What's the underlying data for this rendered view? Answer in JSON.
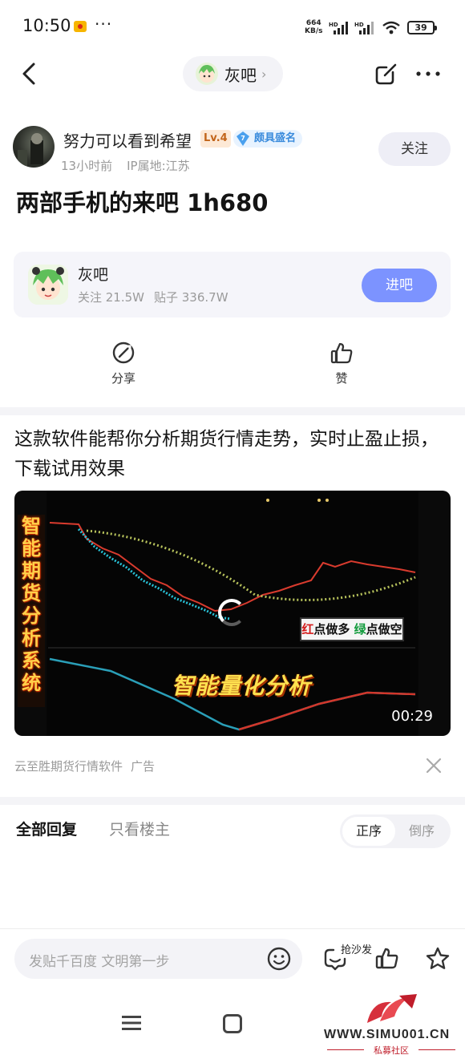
{
  "status_bar": {
    "time": "10:50",
    "dots": "···",
    "net_speed_value": "664",
    "net_speed_unit": "KB/s",
    "signal_tag_1": "HD",
    "signal_tag_2": "HD",
    "battery": "39"
  },
  "nav": {
    "forum_chip_label": "灰吧",
    "chip_arrow": "›"
  },
  "post": {
    "author": "努力可以看到希望",
    "level_badge": "Lv.4",
    "title_level": "7",
    "title_badge": "颇具盛名",
    "time_ago": "13小时前",
    "ip_location": "IP属地:江苏",
    "follow_label": "关注",
    "title": "两部手机的来吧 1h680"
  },
  "forum_card": {
    "name": "灰吧",
    "followers": "关注 21.5W",
    "posts": "贴子 336.7W",
    "enter_label": "进吧"
  },
  "actions": {
    "share_label": "分享",
    "like_label": "赞"
  },
  "ad": {
    "text": "这款软件能帮你分析期货行情走势，实时止盈止损，下载试用效果",
    "video_side_text": [
      "智",
      "能",
      "期",
      "货",
      "分",
      "析",
      "系",
      "统"
    ],
    "red_label": "红",
    "red_suffix": "点做多",
    "green_label": "绿",
    "green_suffix": "点做空",
    "banner_text": "智能量化分析",
    "duration": "00:29",
    "advertiser": "云至胜期货行情软件",
    "ad_tag": "广告"
  },
  "replies": {
    "tab_all": "全部回复",
    "tab_op_only": "只看楼主",
    "sort_asc": "正序",
    "sort_desc": "倒序"
  },
  "bottom_bar": {
    "input_placeholder": "发贴千百度 文明第一步",
    "sofa_label": "抢沙发"
  },
  "watermark": {
    "site": "WWW.SIMU001.CN",
    "sub": "私募社区"
  },
  "colors": {
    "accent_blue": "#7c93ff",
    "level_orange": "#c2651a",
    "title_badge_blue": "#3a8bdc",
    "meta_gray": "#9a9a9a"
  }
}
